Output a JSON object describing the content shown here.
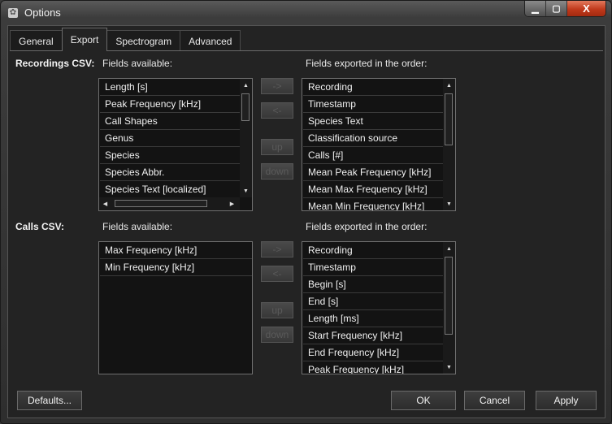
{
  "window": {
    "title": "Options",
    "icon": "gear-icon",
    "caption": {
      "minimize": "▁",
      "maximize": "▢",
      "close": "X"
    }
  },
  "tabs": [
    {
      "label": "General",
      "active": false
    },
    {
      "label": "Export",
      "active": true
    },
    {
      "label": "Spectrogram",
      "active": false
    },
    {
      "label": "Advanced",
      "active": false
    }
  ],
  "recordings": {
    "section_label": "Recordings CSV:",
    "available_label": "Fields available:",
    "exported_label": "Fields exported in the order:",
    "available": [
      "Length [s]",
      "Peak Frequency [kHz]",
      "Call Shapes",
      "Genus",
      "Species",
      "Species Abbr.",
      "Species Text [localized]"
    ],
    "exported": [
      "Recording",
      "Timestamp",
      "Species Text",
      "Classification source",
      "Calls [#]",
      "Mean Peak Frequency [kHz]",
      "Mean Max Frequency [kHz]",
      "Mean Min Frequency [kHz]"
    ]
  },
  "calls": {
    "section_label": "Calls CSV:",
    "available_label": "Fields available:",
    "exported_label": "Fields exported in the order:",
    "available": [
      "Max Frequency [kHz]",
      "Min Frequency [kHz]"
    ],
    "exported": [
      "Recording",
      "Timestamp",
      "Begin [s]",
      "End [s]",
      "Length [ms]",
      "Start Frequency [kHz]",
      "End Frequency [kHz]",
      "Peak Frequency [kHz]"
    ]
  },
  "move_buttons": {
    "add": "->",
    "remove": "<-",
    "up": "up",
    "down": "down"
  },
  "footer": {
    "defaults": "Defaults...",
    "ok": "OK",
    "cancel": "Cancel",
    "apply": "Apply"
  },
  "scroll": {
    "up": "▲",
    "down": "▼",
    "left": "◀",
    "right": "▶"
  }
}
